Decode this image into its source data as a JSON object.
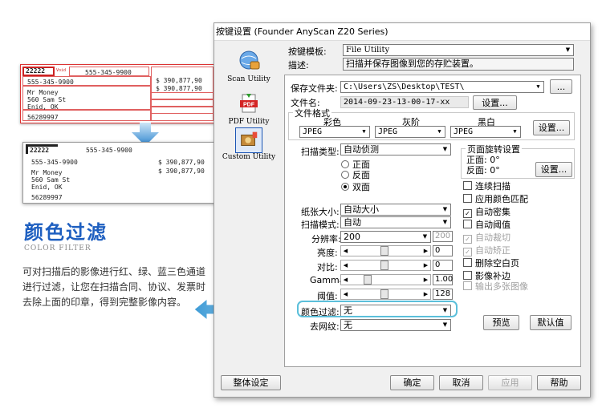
{
  "promo": {
    "title": "颜色过滤",
    "subtitle": "COLOR FILTER",
    "description": "可对扫描后的影像进行红、绿、蓝三色通道进行过滤，让您在扫描合同、协议、发票时去除上面的印章，得到完整影像内容。",
    "doc_top": {
      "code": "22222",
      "void": "Void",
      "employee_ssn": "555-345-9900",
      "employer_id": "555-345-9900",
      "name_line1": "Mr Money",
      "name_line2": "560 Sam St",
      "name_line3": "Enid, OK",
      "control": "56289997",
      "wages": "$ 390,877,90",
      "ss_wages": "$ 390,877,90"
    },
    "doc_bottom": {
      "code": "22222",
      "employee_ssn": "555-345-9900",
      "employer_id": "555-345-9900",
      "name_line1": "Mr Money",
      "name_line2": "560 Sam St",
      "name_line3": "Enid, OK",
      "control": "56289997",
      "wages": "$ 390,877,90",
      "ss_wages": "$ 390,877,90"
    }
  },
  "dialog": {
    "title": "按键设置 (Founder AnyScan Z20 Series)",
    "sidebar": [
      {
        "label": "Scan Utility",
        "icon": "scanner-globe-icon"
      },
      {
        "label": "PDF Utility",
        "icon": "pdf-icon"
      },
      {
        "label": "Custom Utility",
        "icon": "custom-utility-icon"
      }
    ],
    "template_label": "按键模板:",
    "template_value": "File Utility",
    "desc_label": "描述:",
    "desc_value": "扫描并保存图像到您的存贮装置。",
    "save_folder_label": "保存文件夹:",
    "save_folder_value": "C:\\Users\\ZS\\Desktop\\TEST\\",
    "browse_label": "...",
    "filename_label": "文件名:",
    "filename_value": "2014-09-23-13-00-17-xx",
    "settings_label": "设置...",
    "file_format_label": "文件格式",
    "color_label": "彩色",
    "gray_label": "灰阶",
    "bw_label": "黑白",
    "color_format": "JPEG",
    "gray_format": "JPEG",
    "bw_format": "JPEG",
    "scan_type_label": "扫描类型:",
    "scan_type_value": "自动侦测",
    "side_front": "正面",
    "side_back": "反面",
    "side_duplex": "双面",
    "rotation_group": "页面旋转设置",
    "rotation_front": "正面: 0°",
    "rotation_back": "反面: 0°",
    "paper_size_label": "纸张大小:",
    "paper_size_value": "自动大小",
    "scan_mode_label": "扫描模式:",
    "scan_mode_value": "自动",
    "resolution_label": "分辨率:",
    "resolution_value": "200",
    "resolution_spin": "200",
    "brightness_label": "亮度:",
    "brightness_value": "0",
    "contrast_label": "对比:",
    "contrast_value": "0",
    "gamma_label": "Gamma:",
    "gamma_value": "1.00",
    "threshold_label": "阈值:",
    "threshold_value": "128",
    "color_filter_label": "颜色过滤:",
    "color_filter_value": "无",
    "descreen_label": "去网纹:",
    "descreen_value": "无",
    "checks": [
      {
        "label": "连续扫描",
        "checked": false,
        "disabled": false
      },
      {
        "label": "应用颜色匹配",
        "checked": false,
        "disabled": false
      },
      {
        "label": "自动密集",
        "checked": true,
        "disabled": false
      },
      {
        "label": "自动阈值",
        "checked": false,
        "disabled": false
      },
      {
        "label": "自动裁切",
        "checked": true,
        "disabled": true
      },
      {
        "label": "自动矫正",
        "checked": true,
        "disabled": true
      },
      {
        "label": "删除空白页",
        "checked": false,
        "disabled": false
      },
      {
        "label": "影像补边",
        "checked": false,
        "disabled": false
      },
      {
        "label": "输出多张图像",
        "checked": false,
        "disabled": true
      }
    ],
    "preview_label": "预览",
    "defaults_label": "默认值",
    "global_settings_label": "整体设定",
    "ok_label": "确定",
    "cancel_label": "取消",
    "apply_label": "应用",
    "help_label": "帮助",
    "accent_color": "#5bbfda",
    "arrow_color": "#4ea8d8"
  }
}
